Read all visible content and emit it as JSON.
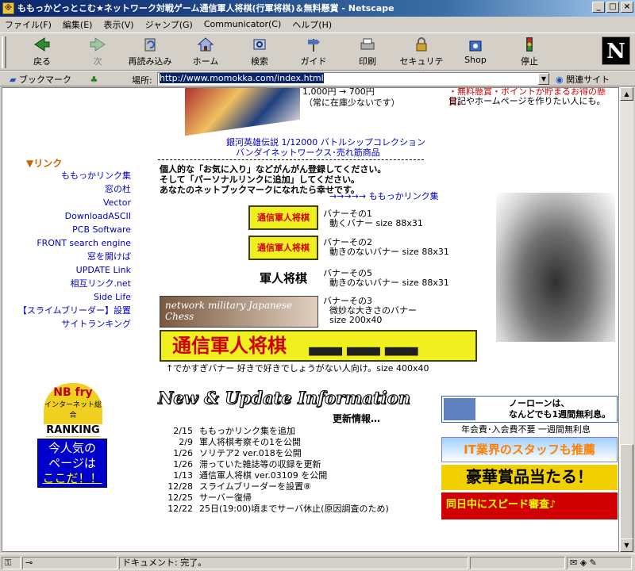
{
  "window": {
    "title": "ももっかどっとこむ★ネットワーク対戦ゲーム通信軍人将棋(行軍将棋)＆無料懸賞 - Netscape",
    "controls": [
      "_",
      "□",
      "×"
    ]
  },
  "menu": [
    "ファイル(F)",
    "編集(E)",
    "表示(V)",
    "ジャンプ(G)",
    "Communicator(C)",
    "ヘルプ(H)"
  ],
  "toolbar": {
    "back": "戻る",
    "forward": "次",
    "reload": "再読み込み",
    "home": "ホーム",
    "search": "検索",
    "guide": "ガイド",
    "print": "印刷",
    "security": "セキュリティ",
    "shop": "Shop",
    "stop": "停止",
    "logo": "N"
  },
  "location": {
    "bookmarks": "ブックマーク",
    "label": "場所:",
    "url": "http://www.momokka.com/index.html",
    "related": "関連サイト"
  },
  "page": {
    "price_line1": "1,000円 → 700円",
    "price_line2": "（常に在庫少ないです）",
    "top_right1": "・無料懸賞・ポイントが貯まるお得の懸賞。",
    "top_right2": "日記やホームページを作りたい人にも。",
    "product_line1": "銀河英雄伝説 1/12000 バトルシップコレクション",
    "product_line2": "バンダイネットワークス･売れ筋商品",
    "link_heading": "▼リンク",
    "links": [
      "ももっかリンク集",
      "窓の杜",
      "Vector",
      "DownloadASCII",
      "PCB Software",
      "FRONT search engine",
      "窓を開けば",
      "UPDATE Link",
      "相互リンク.net",
      "Side Life",
      "【スライムブリーダー】設置",
      "サイトランキング"
    ],
    "intro1": "個人的な「お気に入り」などがんがん登録してください。",
    "intro2": "そして「パーソナルリンクに追加」してください。",
    "intro3": "あなたのネットブックマークになれたら幸せです。",
    "intro_link": "→→→→→ ももっかリンク集",
    "banners": [
      {
        "img": "通信軍人将棋",
        "title": "バナーその1",
        "desc": "動くバナー size 88x31"
      },
      {
        "img": "通信軍人将棋",
        "title": "バナーその2",
        "desc": "動きのないバナー size 88x31"
      },
      {
        "img": "軍人将棋",
        "title": "バナーその5",
        "desc": "動きのないバナー size 88x31"
      },
      {
        "img": "network military Japanese Chess",
        "title": "バナーその3",
        "desc": "微妙な大きさのバナー",
        "desc2": "size 200x40"
      }
    ],
    "big_banner": "通信軍人将棋",
    "big_banner_caption": "↑でかすぎバナー 好きで好きでしょうがない人向け。size 400x40",
    "ranking_top": "NB fry",
    "ranking_mid": "インターネット総合",
    "ranking_bottom": "RANKING",
    "popular1": "今人気の",
    "popular2": "ページは",
    "popular3": "ここだ！！",
    "news_title": "New & Update Information",
    "news_sub": "更新情報…",
    "news": [
      {
        "date": "2/15",
        "text": "ももっかリンク集を追加"
      },
      {
        "date": "2/9",
        "text": "軍人将棋考察その1を公開"
      },
      {
        "date": "1/26",
        "text": "ソリテア2 ver.018を公開"
      },
      {
        "date": "1/26",
        "text": "滞っていた雑誌等の収録を更新"
      },
      {
        "date": "1/13",
        "text": "通信軍人将棋 ver.03109 を公開"
      },
      {
        "date": "12/28",
        "text": "スライムブリーダーを設置⑧"
      },
      {
        "date": "12/25",
        "text": "サーバー復帰"
      },
      {
        "date": "12/22",
        "text": "25日(19:00)頃までサーバ休止(原因調査のため)"
      }
    ],
    "ad1_line1": "ノーローンは、",
    "ad1_line2": "なんどでも1週間無利息。",
    "ad1_caption": "年会費･入会費不要 一週間無利息",
    "ad2": "IT業界のスタッフも推薦",
    "ad3": "豪華賞品当たる！",
    "ad4": "同日中にスピード審査♪"
  },
  "status": {
    "text": "ドキュメント: 完了。"
  }
}
